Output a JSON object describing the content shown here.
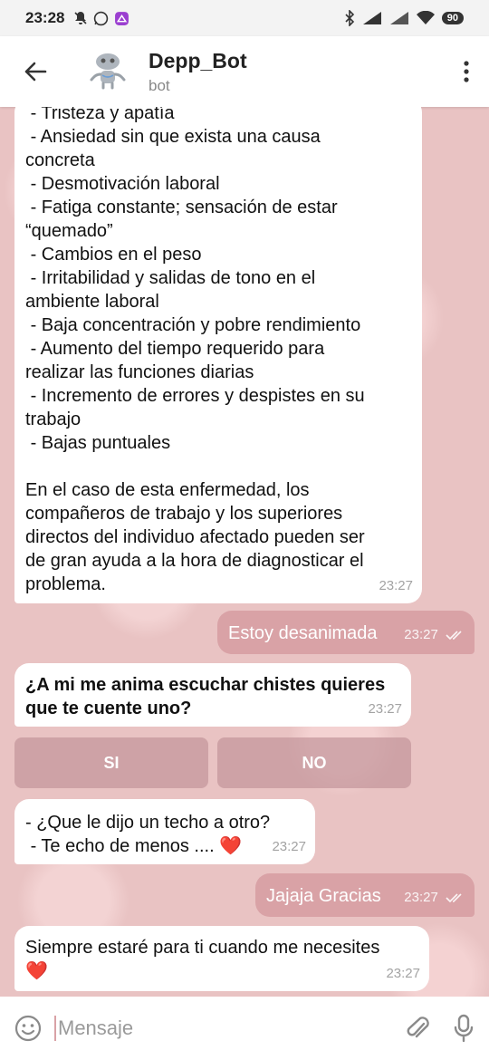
{
  "status_bar": {
    "time": "23:28",
    "battery": "90"
  },
  "header": {
    "title": "Depp_Bot",
    "subtitle": "bot"
  },
  "messages": [
    {
      "direction": "in",
      "text": " - Tristeza y apatía\n - Ansiedad sin que exista una causa\nconcreta\n - Desmotivación laboral\n - Fatiga constante; sensación de estar\n“quemado”\n - Cambios en el peso\n - Irritabilidad y salidas de tono en el\nambiente laboral\n - Baja concentración y pobre rendimiento\n - Aumento del tiempo requerido para\nrealizar las funciones diarias\n - Incremento de errores y despistes en su\ntrabajo\n - Bajas puntuales\n\nEn el caso de esta enfermedad, los\ncompañeros de trabajo y los superiores\ndirectos del individuo afectado pueden ser\nde gran ayuda a la hora de diagnosticar el\nproblema.",
      "time": "23:27"
    },
    {
      "direction": "out",
      "text": "Estoy desanimada",
      "time": "23:27"
    },
    {
      "direction": "in",
      "text": "¿A mi me anima escuchar chistes quieres\nque te cuente uno?",
      "time": "23:27"
    },
    {
      "direction": "in",
      "text": "- ¿Que le dijo un techo a otro?\n - Te echo de menos .... ❤️",
      "time": "23:27"
    },
    {
      "direction": "out",
      "text": "Jajaja Gracias",
      "time": "23:27"
    },
    {
      "direction": "in",
      "text": "Siempre estaré para ti cuando me necesites\n❤️",
      "time": "23:27"
    }
  ],
  "keyboard": {
    "buttons": [
      "SI",
      "NO"
    ]
  },
  "input": {
    "placeholder": "Mensaje"
  },
  "colors": {
    "outgoing_bubble": "#d9a2a6",
    "keyboard_button": "#c4969b",
    "chat_background": "#e9c3c3"
  }
}
